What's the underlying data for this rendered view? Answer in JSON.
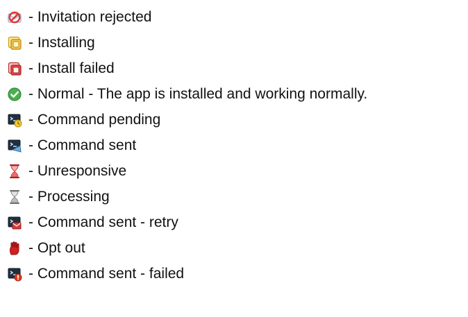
{
  "legend": {
    "items": [
      {
        "icon": "invitation-rejected-icon",
        "text": "- Invitation rejected"
      },
      {
        "icon": "installing-icon",
        "text": "- Installing"
      },
      {
        "icon": "install-failed-icon",
        "text": "- Install failed"
      },
      {
        "icon": "normal-check-icon",
        "text": "- Normal - The app is installed and working normally."
      },
      {
        "icon": "command-pending-icon",
        "text": "- Command pending"
      },
      {
        "icon": "command-sent-icon",
        "text": "- Command sent"
      },
      {
        "icon": "unresponsive-hourglass-icon",
        "text": "- Unresponsive"
      },
      {
        "icon": "processing-hourglass-icon",
        "text": "- Processing"
      },
      {
        "icon": "command-sent-retry-icon",
        "text": "- Command sent - retry"
      },
      {
        "icon": "opt-out-hand-icon",
        "text": "- Opt out"
      },
      {
        "icon": "command-sent-failed-icon",
        "text": "- Command sent - failed"
      }
    ]
  },
  "colors": {
    "text": "#111111",
    "rejected_red": "#e3342f",
    "installing_gold": "#e6b72e",
    "failed_red": "#d83c3c",
    "normal_green": "#4caf50",
    "terminal_dark": "#203040",
    "pending_yellow": "#f3cc2e",
    "sent_blue": "#6fa9d8",
    "retry_red": "#d73b3b",
    "opt_out_red": "#d21f1f",
    "failed_orange_red": "#e23d1f"
  }
}
